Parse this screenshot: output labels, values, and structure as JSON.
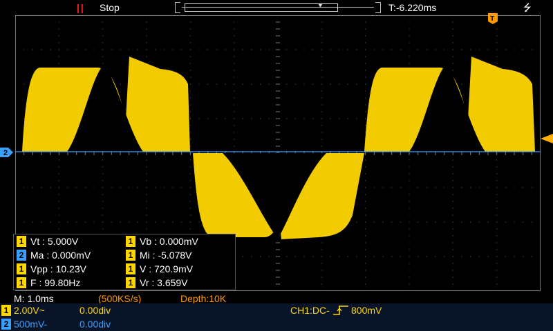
{
  "top": {
    "run_icon": "||",
    "run_state": "Stop",
    "trigger_time": "T:-6.220ms",
    "usb_icon": "usb-icon"
  },
  "channel_markers": {
    "ch2_label": "2",
    "trigger_top_label": "T"
  },
  "measurements": [
    {
      "ch": "1",
      "text": "Vt : 5.000V"
    },
    {
      "ch": "1",
      "text": "Vb : 0.000mV"
    },
    {
      "ch": "2",
      "text": "Ma : 0.000mV"
    },
    {
      "ch": "1",
      "text": "Mi : -5.078V"
    },
    {
      "ch": "1",
      "text": "Vpp : 10.23V"
    },
    {
      "ch": "1",
      "text": "V : 720.9mV"
    },
    {
      "ch": "1",
      "text": "F : 99.80Hz"
    },
    {
      "ch": "1",
      "text": "Vr : 3.659V"
    }
  ],
  "status": {
    "timebase": "M: 1.0ms",
    "sample_rate": "(500KS/s)",
    "depth": "Depth:10K"
  },
  "channels": [
    {
      "badge": "1",
      "scale": "2.00V~",
      "offset": "0.00div",
      "color": "#ffd700"
    },
    {
      "badge": "2",
      "scale": "500mV-",
      "offset": "0.00div",
      "color": "#3aa0ff"
    }
  ],
  "trigger": {
    "label": "CH1:DC-",
    "level": "800mV"
  },
  "colors": {
    "ch1": "#ffd700",
    "ch2": "#3aa0ff",
    "run": "#ff2020",
    "status_orange": "#ff9900"
  }
}
